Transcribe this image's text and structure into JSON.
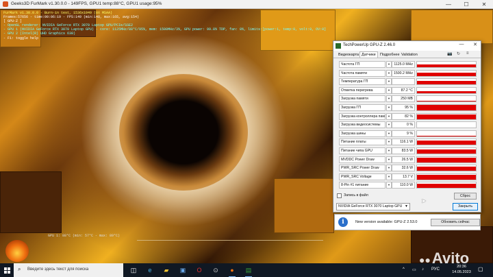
{
  "furmark_window": {
    "title": "Geeks3D FurMark v1.30.0.0 - 149FPS, GPU1 temp:88°C, GPU1 usage:95%",
    "controls": {
      "minimize": "—",
      "maximize": "☐",
      "close": "✕"
    }
  },
  "hud": {
    "lines": [
      "FurMark v1.30.0.0 - Burn-in test, 1536x1049 (0X MSAA)",
      "Frames:57656 - time:00:06:19 - FPS:149 (min:148, max:165, avg:154)",
      "[ GPU-Z ]",
      "- OpenGL renderer: NVIDIA GeForce RTX 3070 Laptop GPU/PCIe/SSE2",
      "- GPU 1 (NVIDIA GeForce RTX 3070 Laptop GPU) - core: 1125MHz/88°C/95%, mem: 1500MHz/3%, GPU power: 99.8% TDP, fan: 0%, limits:[power:1, temp:0, volt:0, OV:0]",
      "- GPU 2 (Intel(R) UHD Graphics 630)",
      "- F1: toggle help"
    ],
    "temp_readout": "GPU 1: 88°C (min: 57°C - max: 89°C)"
  },
  "gpuz": {
    "title": "TechPowerUp GPU-Z 2.46.0",
    "window_controls": {
      "minimize": "—",
      "close": "✕"
    },
    "tabs": [
      "Видеокарта",
      "Датчики",
      "Подробнее",
      "Validation"
    ],
    "active_tab": "Датчики",
    "tab_icons": [
      "📷",
      "↻",
      "≡"
    ],
    "sensors": [
      {
        "label": "Частота ГП",
        "value": "1125.0 MHz",
        "level": 0.45
      },
      {
        "label": "Частота памяти",
        "value": "1500.2 MHz",
        "level": 0.55
      },
      {
        "label": "Температура ГП",
        "value": "",
        "level": 0.62
      },
      {
        "label": "Отметка перегрева",
        "value": "87.2 °C",
        "level": 0.3
      },
      {
        "label": "Загрузка памяти",
        "value": "250 MB",
        "level": 0.12
      },
      {
        "label": "Загрузка ГП",
        "value": "95 %",
        "level": 0.95
      },
      {
        "label": "Загрузка контроллера памяти",
        "value": "82 %",
        "level": 0.82
      },
      {
        "label": "Загрузка видеосистемы",
        "value": "0 %",
        "level": 0.0
      },
      {
        "label": "Загрузка шины",
        "value": "9 %",
        "level": 0.09
      },
      {
        "label": "Питание платы",
        "value": "116.1 W",
        "level": 0.85
      },
      {
        "label": "Питание чипа GPU",
        "value": "83.5 W",
        "level": 0.8
      },
      {
        "label": "MVDDC Power Draw",
        "value": "26.5 W",
        "level": 0.78
      },
      {
        "label": "PWR_SRC Power Draw",
        "value": "32.6 W",
        "level": 0.8
      },
      {
        "label": "PWR_SRC Voltage",
        "value": "13.7 V",
        "level": 0.8
      },
      {
        "label": "8-Pin #1 питание",
        "value": "110.0 W",
        "level": 0.82
      }
    ],
    "log_label": "Запись в файл",
    "reset_label": "Сброс",
    "gpu_selected": "NVIDIA GeForce RTX 3070 Laptop GPU",
    "close_label": "Закрыть",
    "accent_red": "#e00000"
  },
  "update_notice": {
    "message": "New version available: GPU-Z 2.53.0",
    "button": "Обновить сейчас"
  },
  "watermark": "Avito",
  "taskbar": {
    "search_placeholder": "Введите здесь текст для поиска",
    "apps": [
      "task-view-icon",
      "edge-icon",
      "explorer-icon",
      "store-icon",
      "opera-icon",
      "steam-icon",
      "furmark-icon",
      "gpuz-icon"
    ],
    "tray_chevron": "^",
    "language": "РУС",
    "time": "20:36",
    "date": "14.05.2023"
  }
}
